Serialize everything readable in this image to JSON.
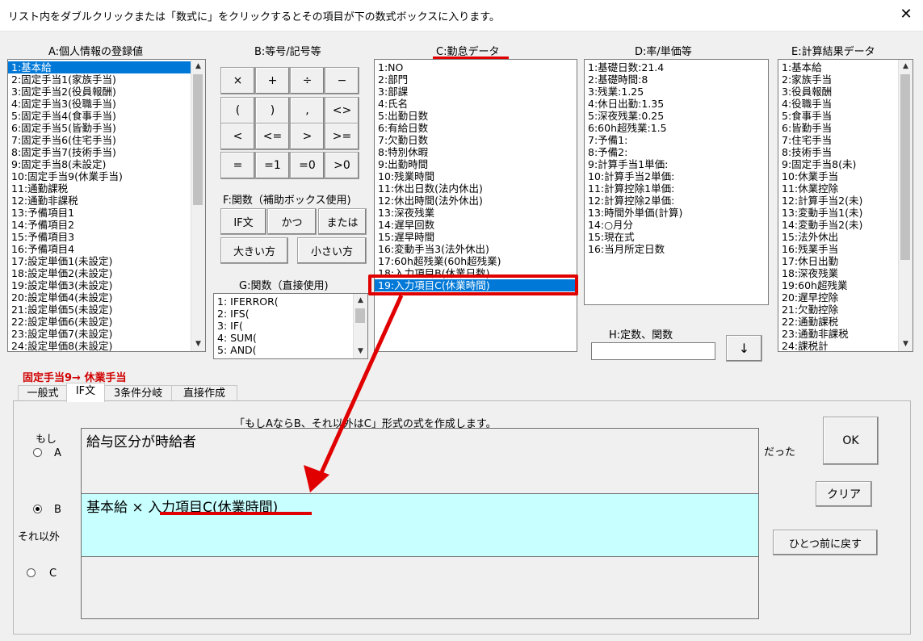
{
  "window": {
    "title": "リスト内をダブルクリックまたは「数式に」をクリックするとその項目が下の数式ボックスに入ります。",
    "close": "✕"
  },
  "listA": {
    "label": "A:個人情報の登録値",
    "items": [
      "1:基本給",
      "2:固定手当1(家族手当)",
      "3:固定手当2(役員報酬)",
      "4:固定手当3(役職手当)",
      "5:固定手当4(食事手当)",
      "6:固定手当5(皆勤手当)",
      "7:固定手当6(住宅手当)",
      "8:固定手当7(技術手当)",
      "9:固定手当8(未設定)",
      "10:固定手当9(休業手当)",
      "11:通勤課税",
      "12:通勤非課税",
      "13:予備項目1",
      "14:予備項目2",
      "15:予備項目3",
      "16:予備項目4",
      "17:設定単価1(未設定)",
      "18:設定単価2(未設定)",
      "19:設定単価3(未設定)",
      "20:設定単価4(未設定)",
      "21:設定単価5(未設定)",
      "22:設定単価6(未設定)",
      "23:設定単価7(未設定)",
      "24:設定単価8(未設定)"
    ]
  },
  "groupB": {
    "label": "B:等号/記号等",
    "buttons": [
      "×",
      "+",
      "÷",
      "−",
      "(",
      ")",
      ",",
      "<>",
      "<",
      "<=",
      ">",
      ">=",
      "=",
      "=1",
      "=0",
      ">0"
    ]
  },
  "groupF": {
    "label": "F:関数（補助ボックス使用)",
    "buttons": [
      "IF文",
      "かつ",
      "または",
      "大きい方",
      "小さい方"
    ]
  },
  "groupG": {
    "label": "G:関数（直接使用)",
    "items": [
      "1: IFERROR(",
      "2: IFS(",
      "3: IF(",
      "4: SUM(",
      "5: AND("
    ]
  },
  "listC": {
    "label": "C:勤怠データ",
    "items": [
      "1:NO",
      "2:部門",
      "3:部課",
      "4:氏名",
      "5:出勤日数",
      "6:有給日数",
      "7:欠勤日数",
      "8:特別休暇",
      "9:出勤時間",
      "10:残業時間",
      "11:休出日数(法内休出)",
      "12:休出時間(法外休出)",
      "13:深夜残業",
      "14:遅早回数",
      "15:遅早時間",
      "16:変動手当3(法外休出)",
      "17:60h超残業(60h超残業)",
      "18:入力項目B(休業日数)",
      "19:入力項目C(休業時間)"
    ]
  },
  "listD": {
    "label": "D:率/単価等",
    "items": [
      "1:基礎日数:21.4",
      "2:基礎時間:8",
      "3:残業:1.25",
      "4:休日出勤:1.35",
      "5:深夜残業:0.25",
      "6:60h超残業:1.5",
      "7:予備1:",
      "8:予備2:",
      "9:計算手当1単価:",
      "10:計算手当2単価:",
      "11:計算控除1単価:",
      "12:計算控除2単価:",
      "13:時間外単価(計算)",
      "14:○月分",
      "15:現在式",
      "16:当月所定日数"
    ]
  },
  "groupH": {
    "label": "H:定数、関数",
    "input_value": "",
    "arrow": "↓"
  },
  "listE": {
    "label": "E:計算結果データ",
    "items": [
      "1:基本給",
      "2:家族手当",
      "3:役員報酬",
      "4:役職手当",
      "5:食事手当",
      "6:皆勤手当",
      "7:住宅手当",
      "8:技術手当",
      "9:固定手当8(未)",
      "10:休業手当",
      "11:休業控除",
      "12:計算手当2(未)",
      "13:変動手当1(未)",
      "14:変動手当2(未)",
      "15:法外休出",
      "16:残業手当",
      "17:休日出勤",
      "18:深夜残業",
      "19:60h超残業",
      "20:遅早控除",
      "21:欠勤控除",
      "22:通勤課税",
      "23:通勤非課税",
      "24:課税計"
    ]
  },
  "target": {
    "text": "固定手当9→ 休業手当"
  },
  "tabs": [
    "一般式",
    "IF文",
    "3条件分岐",
    "直接作成"
  ],
  "ifPanel": {
    "caption": "「もしAならB、それ以外はC」形式の式を作成します。",
    "if_label": "もし",
    "a_label": "A",
    "b_label": "B",
    "else_label": "それ以外",
    "c_label": "C",
    "then_label": "だった",
    "box_a": "給与区分が時給者",
    "box_b_part1": "基本給 × ",
    "box_b_part2": "入力項目C(休業時間)",
    "box_c": "",
    "ok": "OK",
    "clear": "クリア",
    "undo": "ひとつ前に戻す"
  },
  "colors": {
    "selection": "#0078d7",
    "highlight_red": "#e00000",
    "formula_b_bg": "#c8ffff"
  }
}
